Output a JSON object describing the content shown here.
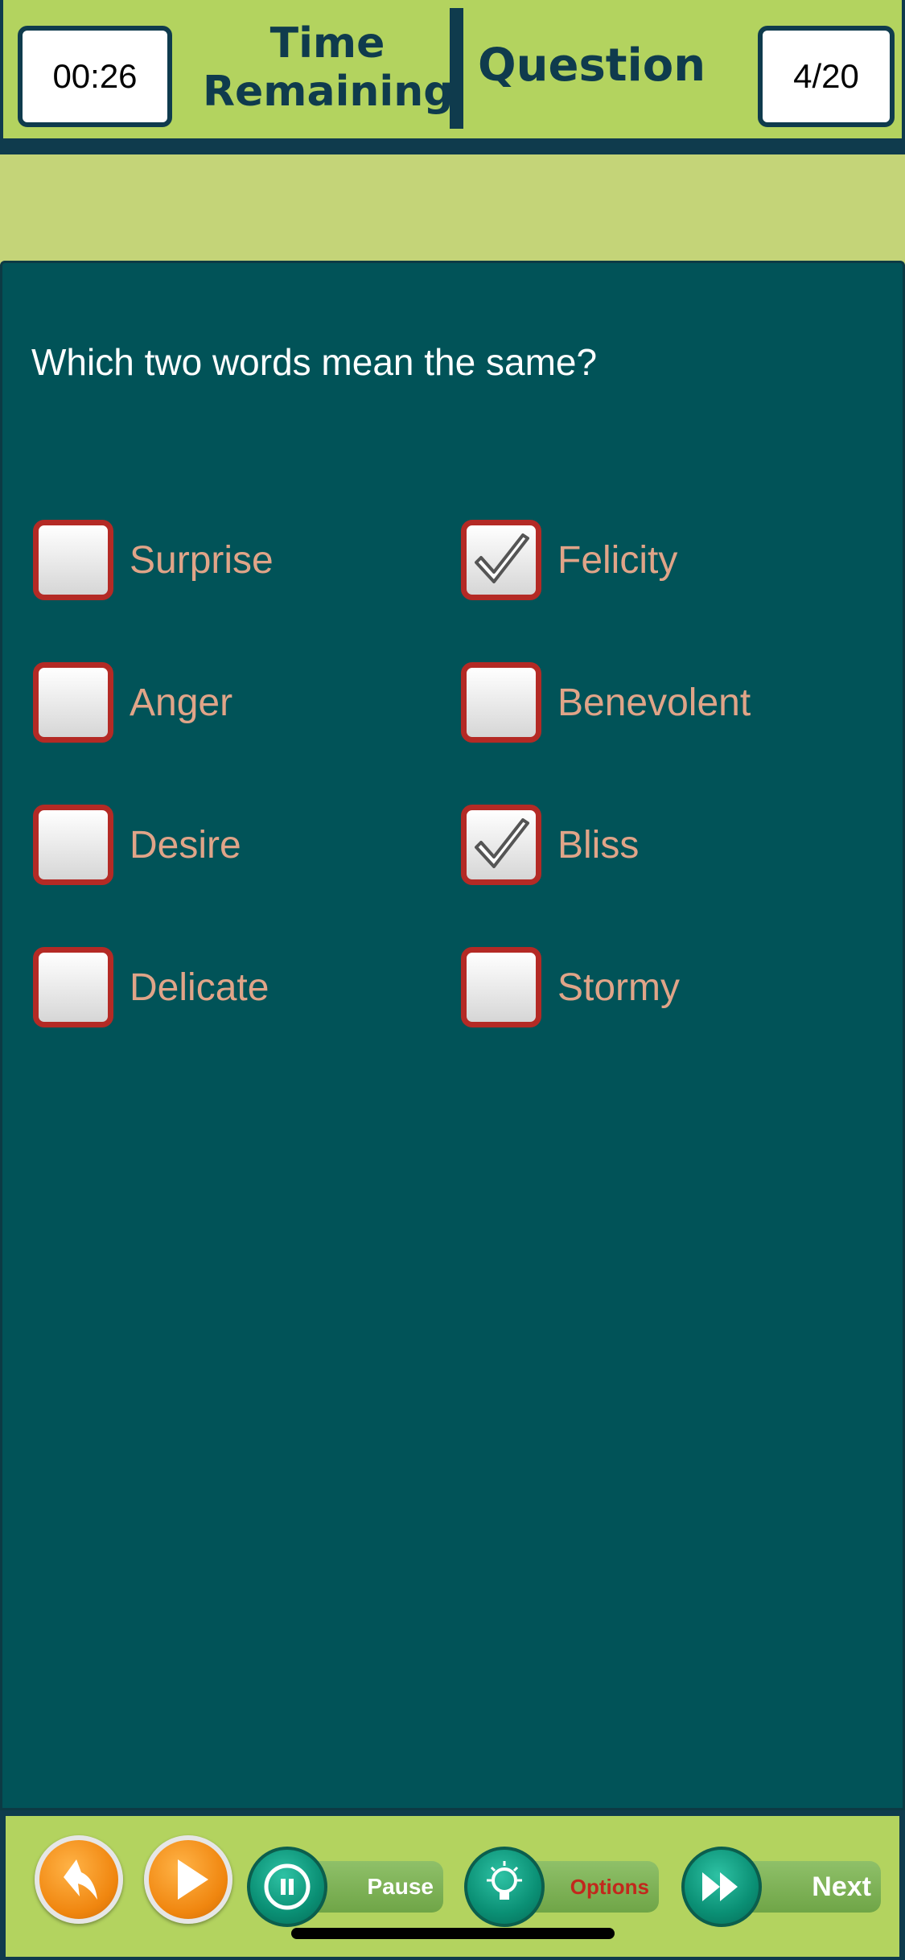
{
  "header": {
    "timer_value": "00:26",
    "time_label_line1": "Time",
    "time_label_line2": "Remaining",
    "question_label": "Question",
    "question_counter": "4/20"
  },
  "quiz": {
    "prompt": "Which two words mean the same?",
    "options": [
      {
        "label": "Surprise",
        "checked": false
      },
      {
        "label": "Felicity",
        "checked": true
      },
      {
        "label": "Anger",
        "checked": false
      },
      {
        "label": "Benevolent",
        "checked": false
      },
      {
        "label": "Desire",
        "checked": false
      },
      {
        "label": "Bliss",
        "checked": true
      },
      {
        "label": "Delicate",
        "checked": false
      },
      {
        "label": "Stormy",
        "checked": false
      }
    ]
  },
  "toolbar": {
    "back_icon": "back-arrow-icon",
    "play_icon": "play-icon",
    "pause_label": "Pause",
    "options_label": "Options",
    "next_label": "Next"
  },
  "colors": {
    "header_bg": "#b3d35f",
    "panel_bg": "#015358",
    "option_text": "#e0a488",
    "checkbox_border": "#b42a25",
    "options_text": "#c2281c"
  }
}
